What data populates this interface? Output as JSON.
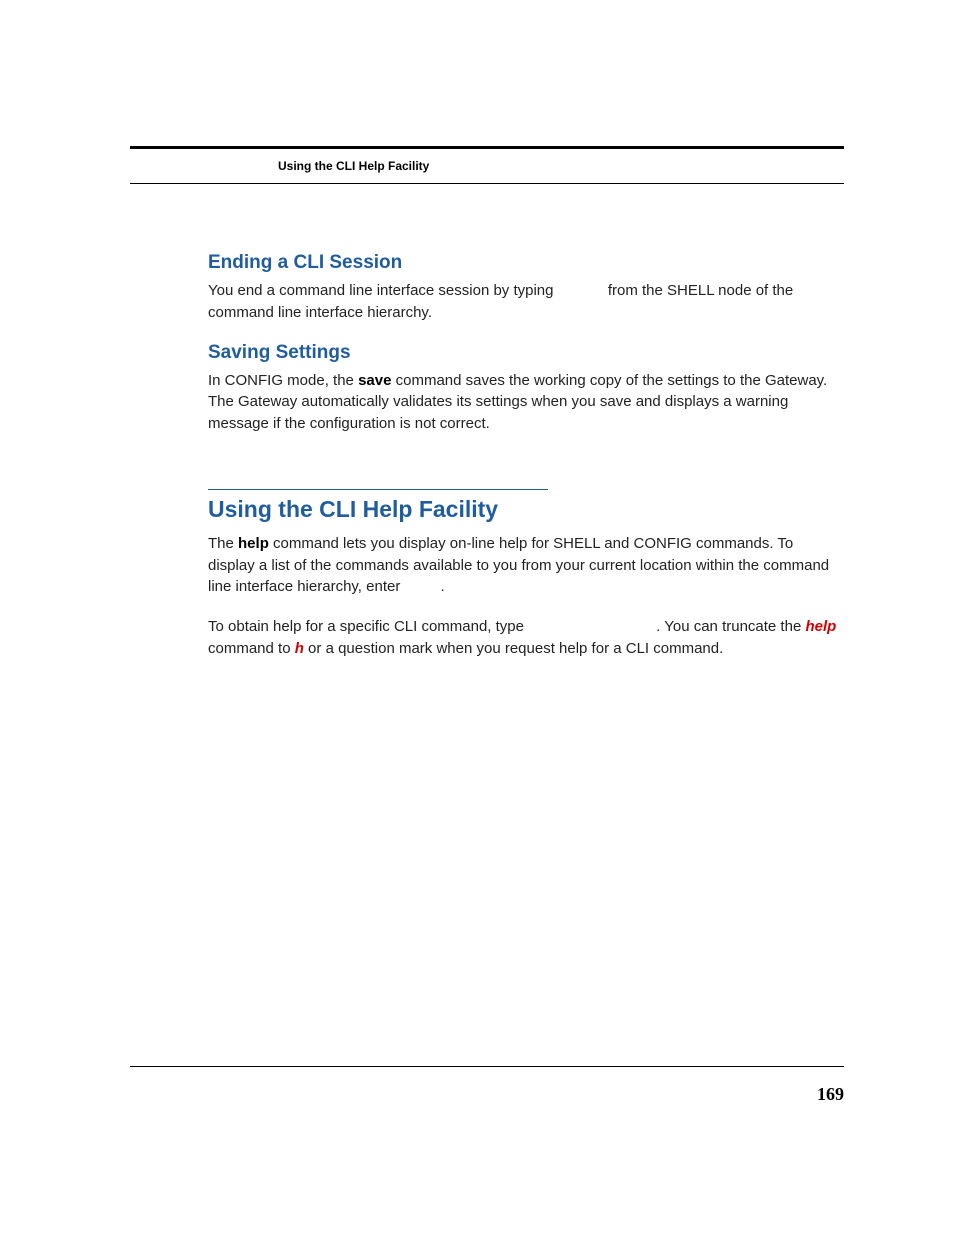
{
  "header": {
    "running_head": "Using the CLI Help Facility"
  },
  "sections": {
    "ending": {
      "title": "Ending a CLI Session",
      "p1a": "You end a command line interface session by typing ",
      "p1b": " from the SHELL node of the command line interface hierarchy."
    },
    "saving": {
      "title": "Saving Settings",
      "p1a": "In CONFIG mode, the ",
      "save_word": "save",
      "p1b": " command saves the working copy of the settings to the Gateway. The Gateway automatically validates its settings when you save and displays a warning message if the configuration is not correct."
    },
    "helpfac": {
      "title": "Using the CLI Help Facility",
      "p1a": "The ",
      "help_word": "help",
      "p1b": " command lets you display on-line help for SHELL and CONFIG commands. To display a list of the commands available to you from your current location within the command line interface hierarchy, enter ",
      "p1c": ".",
      "p2a": "To obtain help for a specific CLI command, type ",
      "p2b": ". You can truncate the ",
      "help_red": "help",
      "p2c": " command to ",
      "h_red": "h",
      "p2d": " or a question mark when you request help for a CLI command."
    }
  },
  "footer": {
    "page_number": "169"
  }
}
